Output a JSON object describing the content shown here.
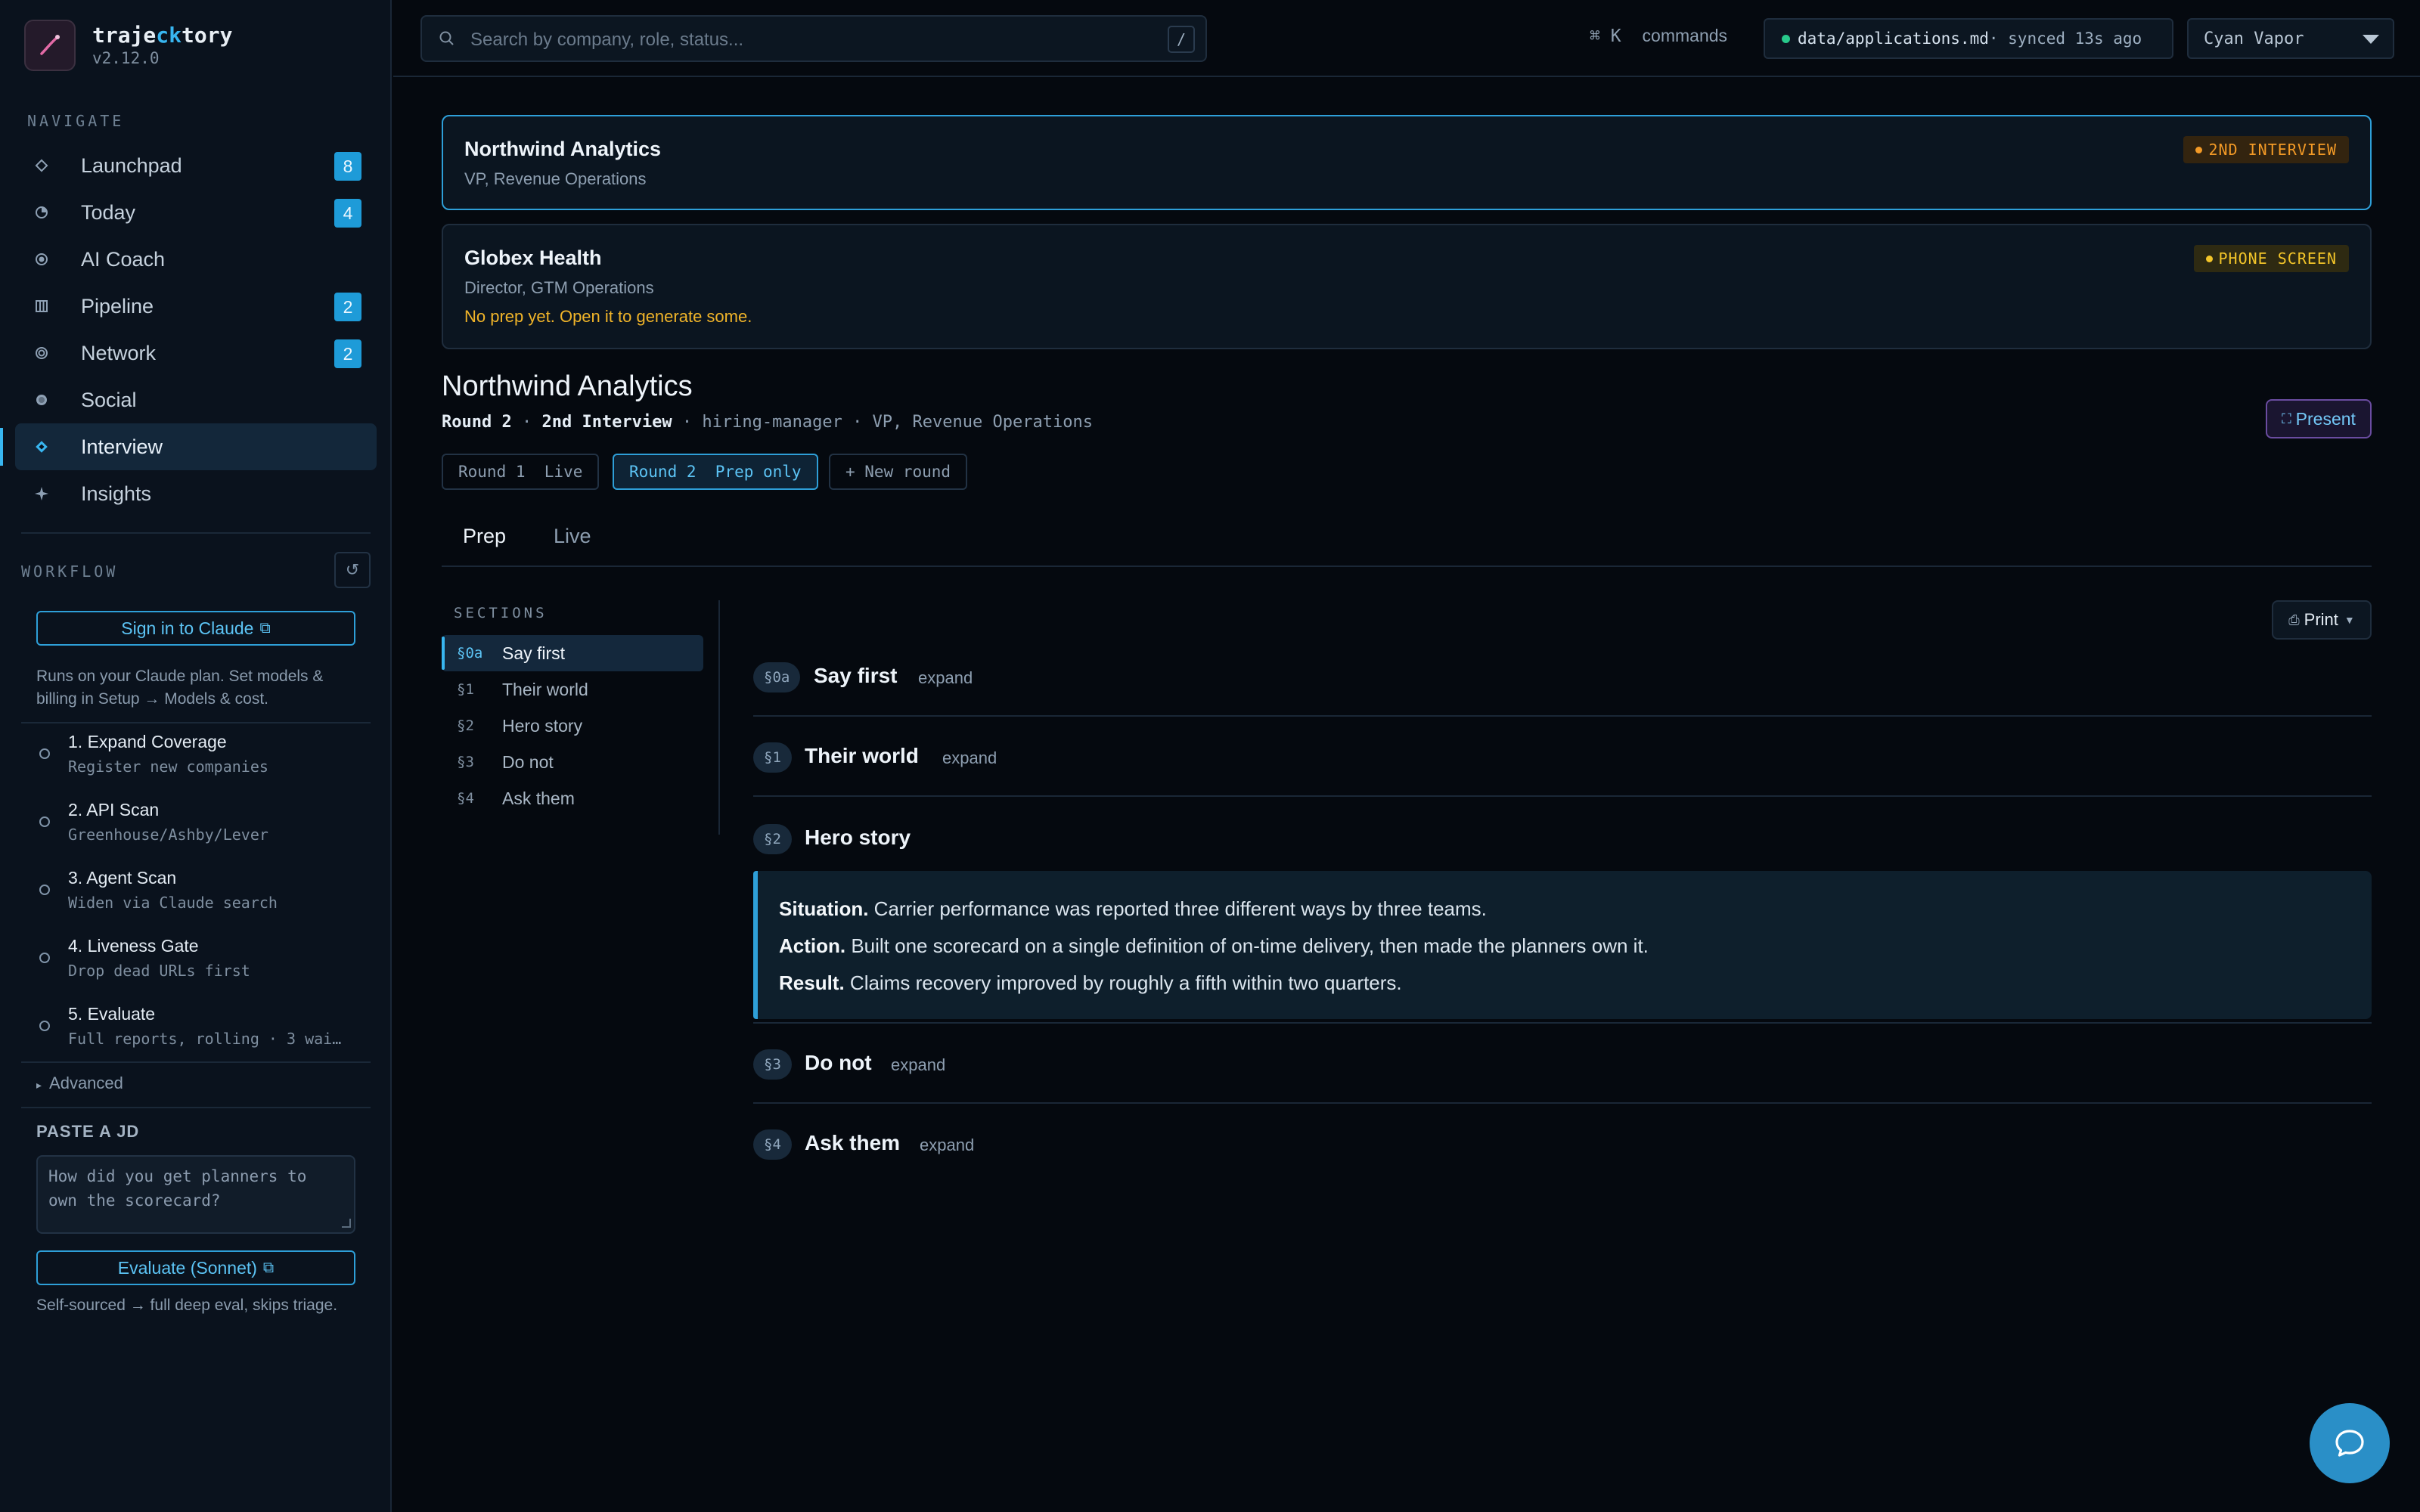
{
  "brand": {
    "name_pre": "traje",
    "name_accent": "ck",
    "name_post": "tory",
    "version": "v2.12.0"
  },
  "sidebar": {
    "navigate_label": "NAVIGATE",
    "nav": [
      {
        "label": "Launchpad",
        "icon": "diamond-outline-icon",
        "badge": "8"
      },
      {
        "label": "Today",
        "icon": "clock-icon",
        "badge": "4"
      },
      {
        "label": "AI Coach",
        "icon": "target-icon",
        "badge": ""
      },
      {
        "label": "Pipeline",
        "icon": "columns-icon",
        "badge": "2"
      },
      {
        "label": "Network",
        "icon": "ring-icon",
        "badge": "2"
      },
      {
        "label": "Social",
        "icon": "globe-icon",
        "badge": ""
      },
      {
        "label": "Interview",
        "icon": "diamond-filled-icon",
        "badge": "",
        "active": true
      },
      {
        "label": "Insights",
        "icon": "sparkle-icon",
        "badge": ""
      }
    ],
    "workflow_label": "WORKFLOW",
    "signin_label": "Sign in to Claude",
    "plan_note": "Runs on your Claude plan. Set models & billing in Setup → Models & cost.",
    "steps": [
      {
        "title": "1. Expand Coverage",
        "sub": "Register new companies"
      },
      {
        "title": "2. API Scan",
        "sub": "Greenhouse/Ashby/Lever"
      },
      {
        "title": "3. Agent Scan",
        "sub": "Widen via Claude search"
      },
      {
        "title": "4. Liveness Gate",
        "sub": "Drop dead URLs first"
      },
      {
        "title": "5. Evaluate",
        "sub": "Full reports, rolling · 3 wai…"
      }
    ],
    "advanced_label": "Advanced",
    "paste_label": "PASTE A JD",
    "jd_value": "How did you get planners to own the scorecard?",
    "evaluate_label": "Evaluate (Sonnet)",
    "evaluate_note": "Self-sourced → full deep eval, skips triage."
  },
  "topbar": {
    "search_placeholder": "Search by company, role, status...",
    "search_kbd": "/",
    "cmd_keys": "⌘ K",
    "cmd_label": "commands",
    "sync_file": "data/applications.md",
    "sync_status": " · synced 13s ago",
    "theme": "Cyan Vapor"
  },
  "applications": [
    {
      "company": "Northwind Analytics",
      "role": "VP, Revenue Operations",
      "status": "2ND INTERVIEW",
      "note": ""
    },
    {
      "company": "Globex Health",
      "role": "Director, GTM Operations",
      "status": "PHONE SCREEN",
      "note": "No prep yet. Open it to generate some."
    }
  ],
  "detail": {
    "company": "Northwind Analytics",
    "round": "Round 2",
    "stage": "2nd Interview",
    "meta_rest": " · hiring-manager · VP, Revenue Operations",
    "sep": " · ",
    "present_label": "Present",
    "rounds": [
      "Round 1  Live",
      "Round 2  Prep only",
      "+ New round"
    ],
    "subtabs": [
      "Prep",
      "Live"
    ],
    "sections_label": "SECTIONS",
    "print_label": "Print",
    "sections": [
      {
        "num": "§0a",
        "title": "Say first",
        "action": "expand"
      },
      {
        "num": "§1",
        "title": "Their world",
        "action": "expand"
      },
      {
        "num": "§2",
        "title": "Hero story",
        "action": ""
      },
      {
        "num": "§3",
        "title": "Do not",
        "action": "expand"
      },
      {
        "num": "§4",
        "title": "Ask them",
        "action": "expand"
      }
    ],
    "story": {
      "situation_label": "Situation.",
      "situation": " Carrier performance was reported three different ways by three teams.",
      "action_label": "Action.",
      "action": " Built one scorecard on a single definition of on-time delivery, then made the planners own it.",
      "result_label": "Result.",
      "result": " Claims recovery improved by roughly a fifth within two quarters."
    }
  },
  "colors": {
    "accent": "#38b6f0",
    "bg": "#05090f",
    "sidebar": "#0a121d",
    "orange": "#f39a26",
    "yellow": "#f3c529",
    "present_border": "#6a4ca0"
  }
}
